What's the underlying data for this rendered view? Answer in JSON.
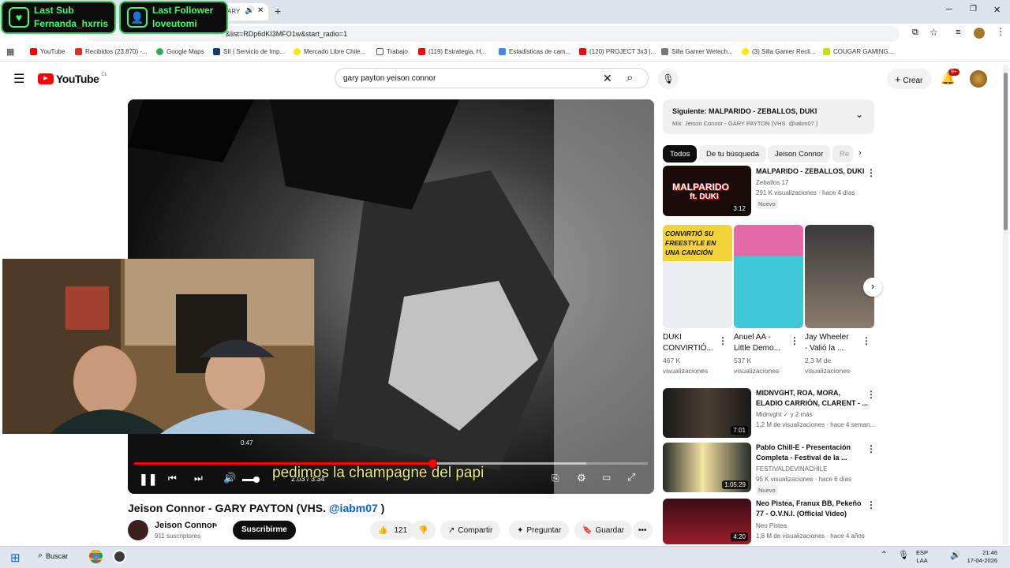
{
  "overlays": {
    "sub": {
      "title": "Last Sub",
      "name": "Fernanda_hxrris"
    },
    "follower": {
      "title": "Last Follower",
      "name": "loveutomi"
    }
  },
  "browser": {
    "tab_title_fragment": "ARY",
    "url": "&list=RDp6dKI3MFO1w&start_radio=1",
    "bookmarks": [
      "YouTube",
      "Recibidos (23.870) -...",
      "Google Maps",
      "SII | Servicio de Imp...",
      "Mercado Libre Chile...",
      "Trabajo",
      "(119) Estrategia, H...",
      "Estadísticas de cam...",
      "(120) PROJECT 3x3 |...",
      "Silla Gamer Wetech...",
      "(3) Silla Gamer Recli...",
      "COUGAR GAMING..."
    ]
  },
  "youtube": {
    "logo_text": "YouTube",
    "logo_region": "CL",
    "search_value": "gary payton yeison connor",
    "create_label": "Crear",
    "notif_count": "9+"
  },
  "player": {
    "hover_time": "0:47",
    "time_display": "2:03 / 3:34",
    "subtitle": "pedimos la champagne del papi",
    "progress_fraction": 0.58,
    "buffer_fraction": 0.88
  },
  "video": {
    "title_main": "Jeison Connor - GARY PAYTON (VHS. ",
    "title_link": "@iabm07",
    "title_end": " )",
    "channel": "Jeison Connor",
    "subscribers": "911 suscriptores",
    "subscribe_label": "Suscribirme",
    "likes": "121",
    "share_label": "Compartir",
    "ask_label": "Preguntar",
    "save_label": "Guardar"
  },
  "sidebar": {
    "next_label": "Siguiente: MALPARIDO - ZEBALLOS, DUKI",
    "mix_label": "Mix: Jeison Connor - GARY PAYTON (VHS. @iabm07 )",
    "chips": [
      "Todos",
      "De tu búsqueda",
      "Jeison Connor",
      "Re"
    ],
    "first": {
      "title": "MALPARIDO - ZEBALLOS, DUKI",
      "channel": "Zeballos 17",
      "meta": "291 K visualizaciones · hace 4 días",
      "badge": "Nuevo",
      "duration": "3:12",
      "thumb_text_1": "MALPARIDO",
      "thumb_text_2": "ft. DUKI"
    },
    "shorts": [
      {
        "title_1": "DUKI",
        "title_2": "CONVIRTIÓ...",
        "views_1": "467 K",
        "views_2": "visualizaciones",
        "thumb_text": "CONVIRTIÓ SU FREESTYLE EN UNA CANCIÓN"
      },
      {
        "title_1": "Anuel AA -",
        "title_2": "Little Demo...",
        "views_1": "537 K",
        "views_2": "visualizaciones"
      },
      {
        "title_1": "Jay Wheeler",
        "title_2": "- Valió la ...",
        "views_1": "2,3 M de",
        "views_2": "visualizaciones"
      }
    ],
    "items": [
      {
        "title_1": "MIDNVGHT, ROA, MORA,",
        "title_2": "ELADIO CARRIÓN, CLARENT - ...",
        "channel": "Midnvght",
        "meta_1": "y 2 más",
        "meta_2": "1,2 M de visualizaciones · hace 4 seman...",
        "duration": "7:01"
      },
      {
        "title_1": "Pablo Chill-E - Presentación",
        "title_2": "Completa - Festival de la ...",
        "channel": "FESTIVALDEVINACHILE",
        "meta_2": "95 K visualizaciones · hace 6 días",
        "badge": "Nuevo",
        "duration": "1:05:29"
      },
      {
        "title_1": "Neo Pistea, Franux BB, Pekeño",
        "title_2": "77 - O.V.N.I. (Official Video)",
        "channel": "Neo Pistea",
        "meta_2": "1,8 M de visualizaciones · hace 4 años",
        "duration": "4:20"
      }
    ]
  },
  "taskbar": {
    "search_label": "Buscar",
    "lang_1": "ESP",
    "lang_2": "LAA",
    "time": "21:46",
    "date": "17-04-2026"
  }
}
